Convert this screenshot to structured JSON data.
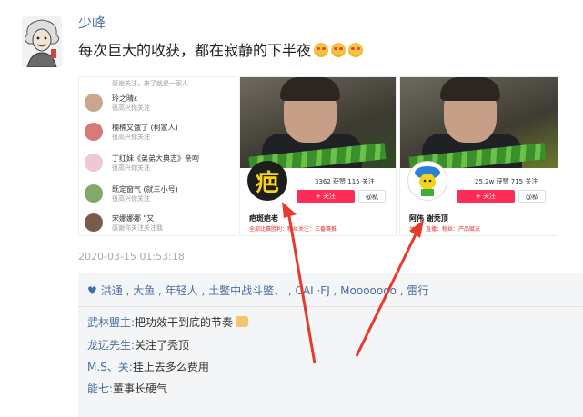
{
  "post": {
    "username": "少峰",
    "text": "每次巨大的收获，都在寂静的下半夜",
    "emojis": [
      "heart-eyes-emoji",
      "heart-eyes-emoji",
      "heart-eyes-emoji"
    ],
    "timestamp": "2020-03-15 01:53:18"
  },
  "images": {
    "chat_list": [
      {
        "name": "",
        "sub": "感谢关注，来了就是一家人",
        "time": ""
      },
      {
        "name": "玲之晴ε",
        "sub": "很高兴你关注",
        "time": ""
      },
      {
        "name": "楠楠又饿了 (柯家人)",
        "sub": "很高兴你关注",
        "time": ""
      },
      {
        "name": "丁红妹《弟弟大典志》亲吻",
        "sub": "很高兴你关注",
        "time": ""
      },
      {
        "name": "既定窗气 (就三小号)",
        "sub": "很高兴你关注",
        "time": ""
      },
      {
        "name": "宋娜娜娜 \"又",
        "sub": "感谢你关注关注我",
        "time": ""
      }
    ],
    "profile_left": {
      "avatar_char": "疤",
      "stats": "3362 获赞   115 关注",
      "follow_button": "+ 关注",
      "dm_button": "@私",
      "name": "疤斑疤老",
      "desc": "全部比赛胜利：粉丝关注：三番赛推"
    },
    "profile_right": {
      "stats": "25.2w 获赞   715 关注",
      "follow_button": "+ 关注",
      "dm_button": "@私",
      "name": "阿伟 谢秃顶",
      "desc": "关注：直播：粉丝：产品赋友"
    }
  },
  "interactions": {
    "likes_line": "洪通 , 大鱼 , 年轻人 , 土鳖中战斗鳖、 , CAI ·FJ , Mooooooo , 雷行",
    "comments": [
      {
        "user": "武林盟主:",
        "text": "把功效干到底的节奏"
      },
      {
        "user": "龙远先生:",
        "text": "关注了秃顶"
      },
      {
        "user": "M.S、关:",
        "text": "挂上去多么费用"
      },
      {
        "user": "能七:",
        "text": "董事长硬气"
      }
    ]
  },
  "colors": {
    "link": "#4a6f9e",
    "arrow": "#e8392b",
    "follow": "#fe2c55"
  }
}
